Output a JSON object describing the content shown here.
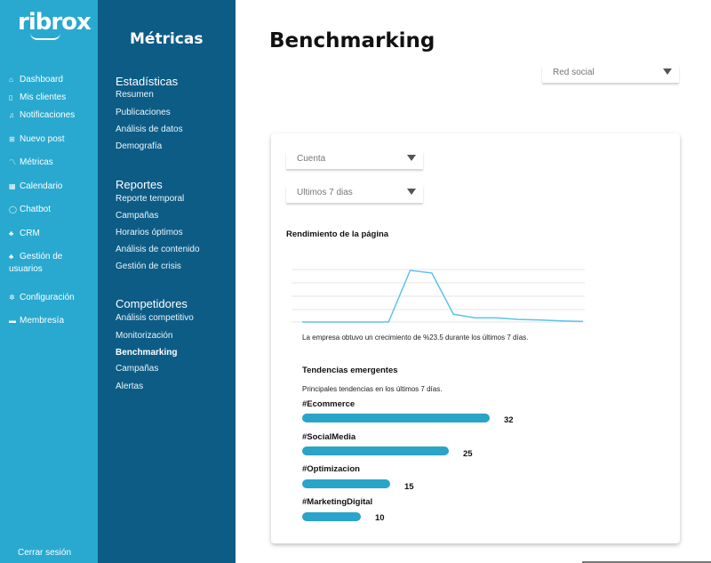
{
  "brand": {
    "logo": "ribrox"
  },
  "rail": {
    "items": [
      {
        "icon": "home-icon",
        "glyph": "⌂",
        "label": "Dashboard"
      },
      {
        "icon": "phone-icon",
        "glyph": "▯",
        "label": "Mis clientes"
      },
      {
        "icon": "bell-icon",
        "glyph": "♫",
        "label": "Notificaciones"
      },
      {
        "icon": "plus-square-icon",
        "glyph": "⊞",
        "label": "Nuevo post"
      },
      {
        "icon": "trend-icon",
        "glyph": "〽",
        "label": "Métricas"
      },
      {
        "icon": "calendar-icon",
        "glyph": "▦",
        "label": "Calendario"
      },
      {
        "icon": "chat-icon",
        "glyph": "◯",
        "label": "Chatbot"
      },
      {
        "icon": "people-icon",
        "glyph": "♣",
        "label": "CRM"
      },
      {
        "icon": "users-icon",
        "glyph": "♣",
        "label": "Gestión de usuarios"
      },
      {
        "icon": "gear-icon",
        "glyph": "✲",
        "label": "Configuración"
      },
      {
        "icon": "card-icon",
        "glyph": "▬",
        "label": "Membresía"
      }
    ],
    "logout": "Cerrar sesión"
  },
  "panel": {
    "title": "Métricas",
    "groups": [
      {
        "heading": "Estadísticas",
        "items": [
          "Resumen",
          "Publicaciones",
          "Análisis de datos",
          "Demografía"
        ]
      },
      {
        "heading": "Reportes",
        "items": [
          "Reporte temporal",
          "Campañas",
          "Horarios óptimos",
          "Análisis de contenido",
          "Gestión de crisis"
        ]
      },
      {
        "heading": "Competidores",
        "items": [
          "Análisis competitivo",
          "Monitorización",
          "Benchmarking",
          "Campañas",
          "Alertas"
        ]
      }
    ],
    "active": "Benchmarking"
  },
  "main": {
    "title": "Benchmarking",
    "network_select": "Red social",
    "account_select": "Cuenta",
    "period_select": "Ultimos 7 dias",
    "performance_title": "Rendimiento de la página",
    "growth_note": "La empresa obtuvo un crecimiento de %23.5 durante los últimos 7 días.",
    "trends_title": "Tendencias emergentes",
    "trends_subtitle": "Principales tendencias en los últimos 7 días."
  },
  "chart_data": {
    "type": "line",
    "title": "Rendimiento de la página",
    "x": [
      0,
      1,
      2,
      3,
      4,
      5,
      6,
      7,
      8,
      9,
      10,
      11,
      12,
      13
    ],
    "series": [
      {
        "values": [
          0,
          0,
          0,
          0,
          0,
          1.0,
          0.95,
          0.15,
          0.08,
          0.08,
          0.05,
          0.04,
          0.02,
          0.01
        ]
      }
    ],
    "line_color": "#5bc3ec",
    "grid": true
  },
  "trends": [
    {
      "tag": "#Ecommerce",
      "value": 32
    },
    {
      "tag": "#SocialMedia",
      "value": 25
    },
    {
      "tag": "#Optimizacion",
      "value": 15
    },
    {
      "tag": "#MarketingDigital",
      "value": 10
    }
  ],
  "colors": {
    "rail": "#29a9cf",
    "panel": "#0d5c86",
    "bar": "#2aa4c9",
    "line": "#5bc3ec"
  }
}
